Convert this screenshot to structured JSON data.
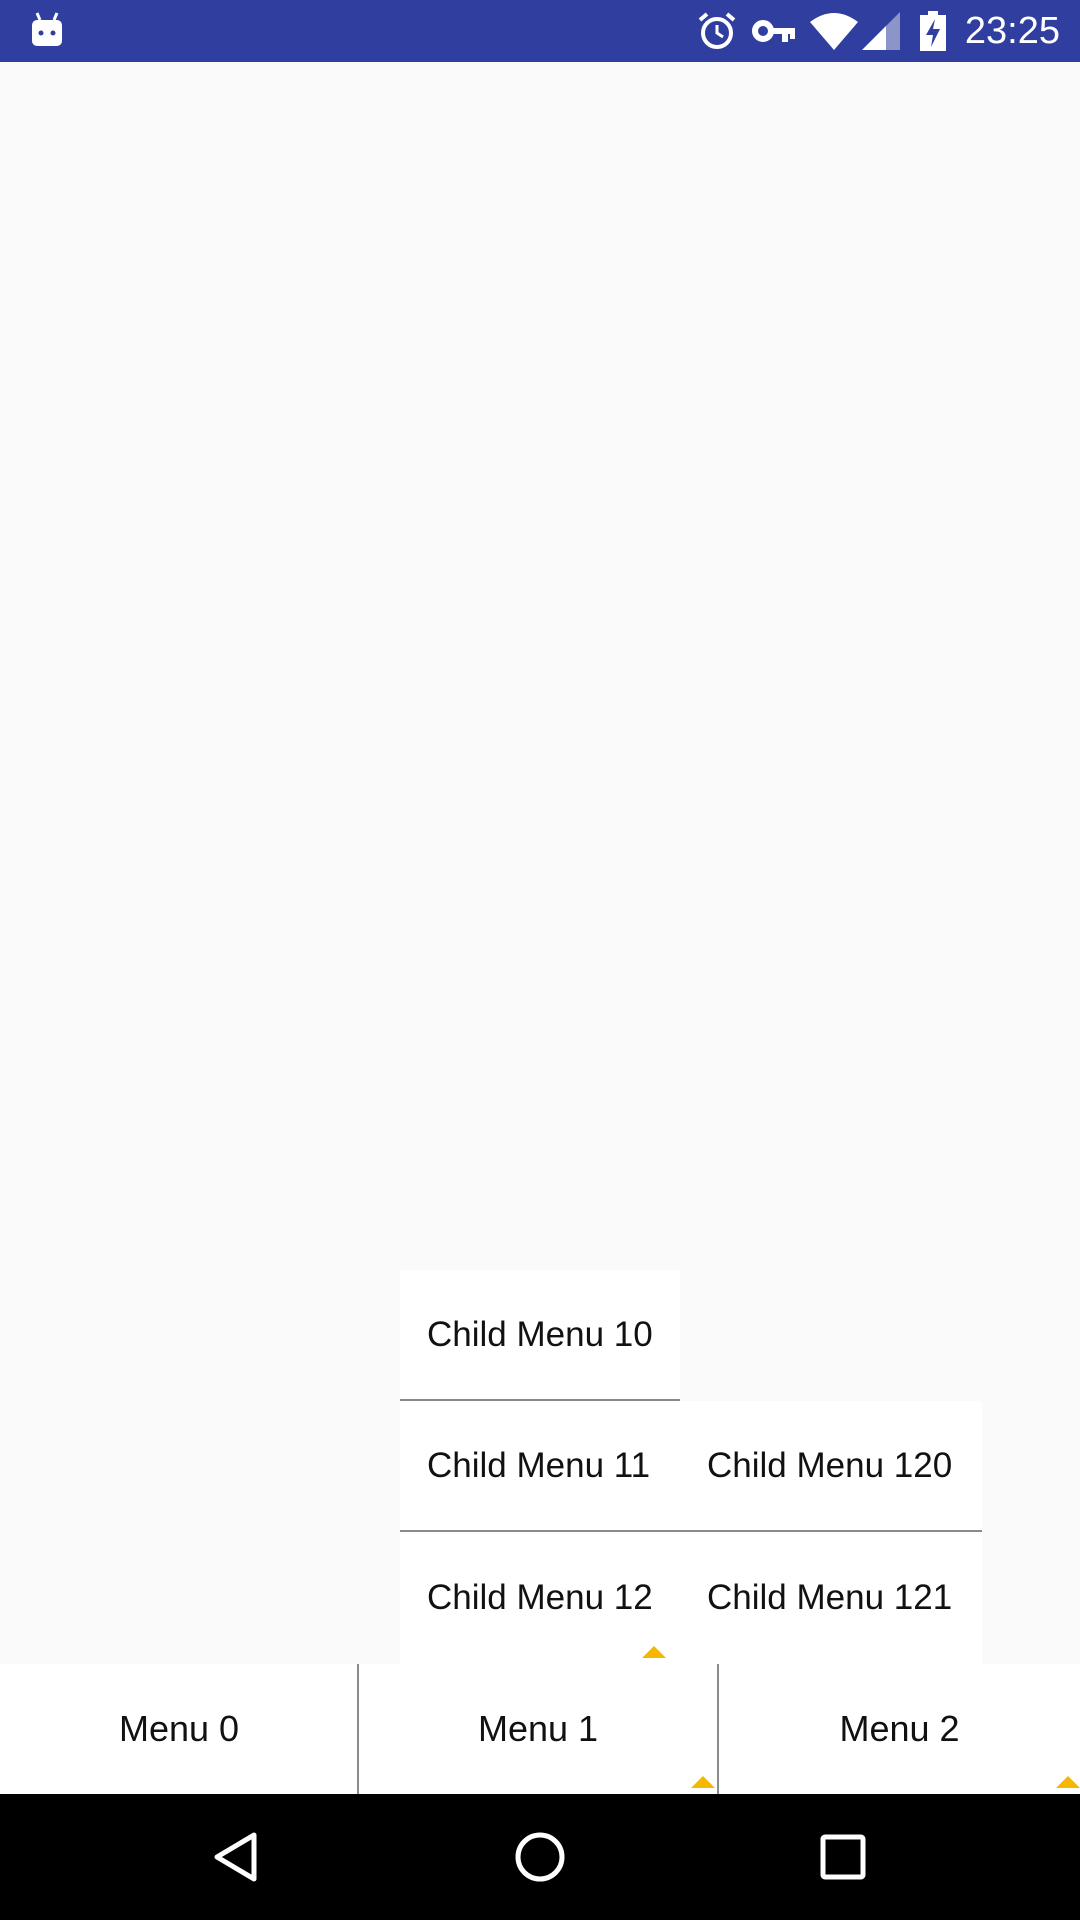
{
  "status_bar": {
    "time": "23:25",
    "icons": [
      "android-icon",
      "alarm-icon",
      "vpn-key-icon",
      "wifi-icon",
      "signal-icon",
      "battery-charging-icon"
    ],
    "background_color": "#303f9f"
  },
  "popup_menu": {
    "level1": [
      {
        "label": "Child Menu 10"
      },
      {
        "label": "Child Menu 11"
      },
      {
        "label": "Child Menu 12"
      }
    ],
    "level2": [
      {
        "label": "Child Menu 120"
      },
      {
        "label": "Child Menu 121"
      }
    ],
    "accent_color": "#f5b800"
  },
  "bottom_menu": {
    "tabs": [
      {
        "label": "Menu 0"
      },
      {
        "label": "Menu 1"
      },
      {
        "label": "Menu 2"
      }
    ]
  },
  "nav_bar": {
    "icons": [
      "back-icon",
      "home-icon",
      "recents-icon"
    ]
  }
}
